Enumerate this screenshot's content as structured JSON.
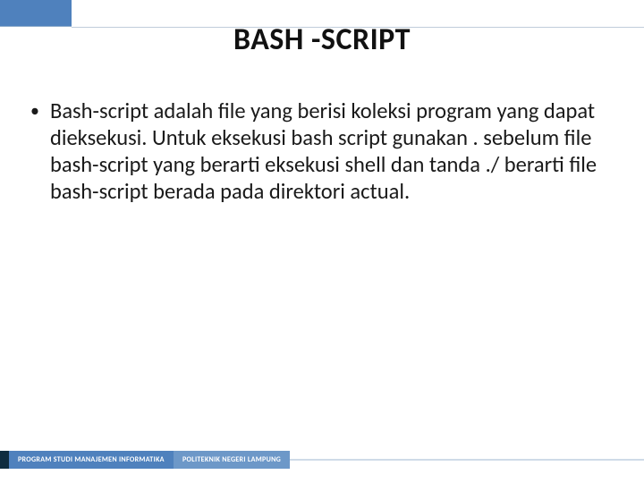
{
  "title": "BASH -SCRIPT",
  "bullets": [
    "Bash-script adalah file yang berisi koleksi program yang dapat dieksekusi. Untuk eksekusi bash script gunakan . sebelum file bash-script yang berarti eksekusi shell dan tanda ./ berarti file bash-script berada pada direktori actual."
  ],
  "footer": {
    "left": "PROGRAM STUDI MANAJEMEN INFORMATIKA",
    "right": "POLITEKNIK NEGERI LAMPUNG"
  }
}
